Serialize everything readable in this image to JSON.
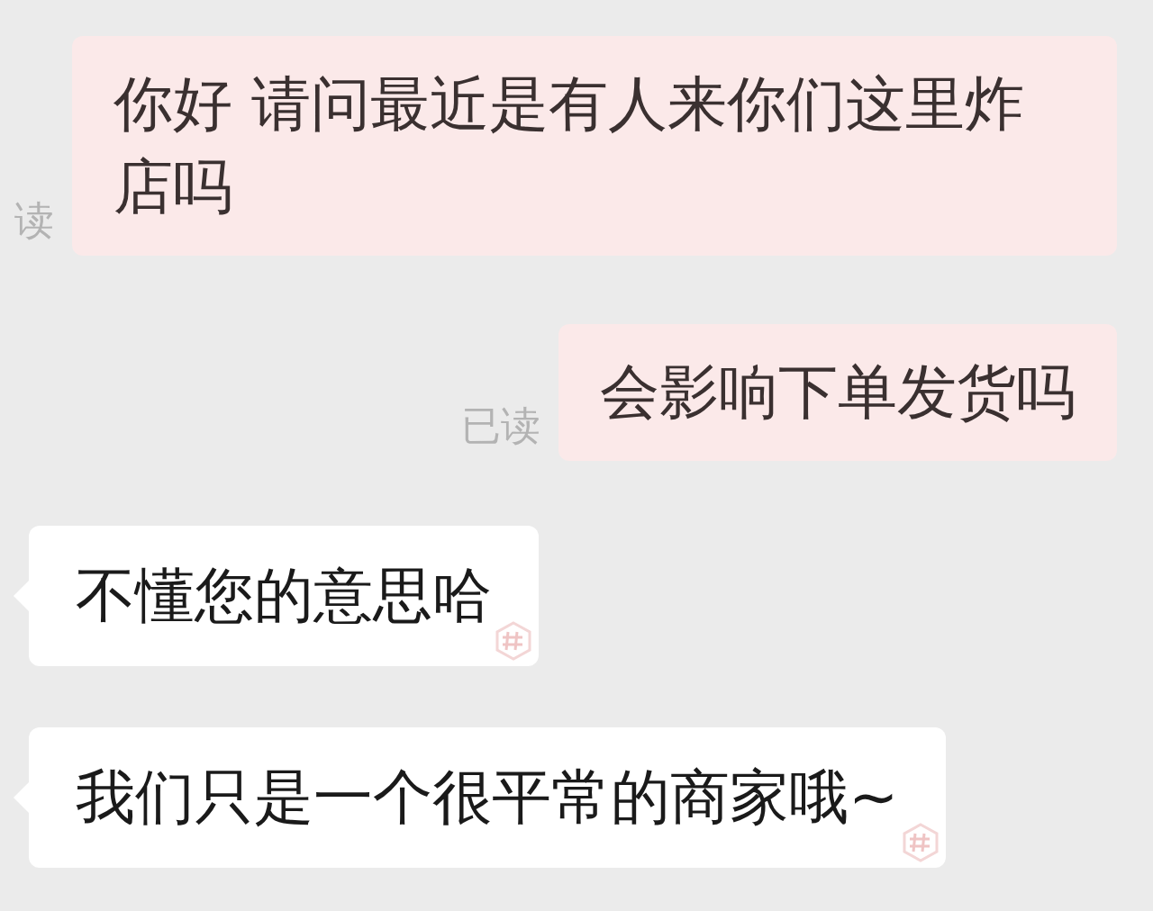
{
  "messages": [
    {
      "kind": "sent",
      "text": "你好 请问最近是有人来你们这里炸店吗",
      "receipt": "读"
    },
    {
      "kind": "sent",
      "text": "会影响下单发货吗",
      "receipt": "已读"
    },
    {
      "kind": "received",
      "text": "不懂您的意思哈"
    },
    {
      "kind": "received",
      "text": "我们只是一个很平常的商家哦~"
    }
  ]
}
